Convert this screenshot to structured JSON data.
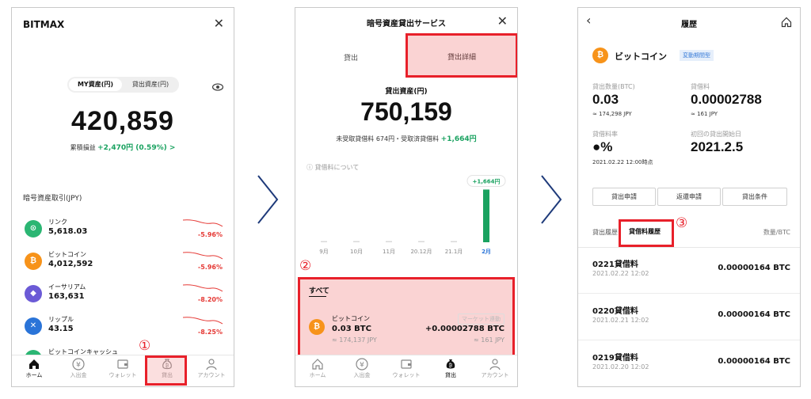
{
  "screen1": {
    "brand": "BITMAX",
    "pill_my": "MY資産(円)",
    "pill_lend": "貸出資産(円)",
    "total": "420,859",
    "pl_label": "累積損益",
    "pl_value": "+2,470円 (0.59%) >",
    "section_title": "暗号資産取引(JPY)",
    "coins": [
      {
        "name": "リンク",
        "price": "5,618.03",
        "change": "-5.96%",
        "color": "#2bb673",
        "glyph": "⊙"
      },
      {
        "name": "ビットコイン",
        "price": "4,012,592",
        "change": "-5.96%",
        "color": "#f7931a",
        "glyph": "₿"
      },
      {
        "name": "イーサリアム",
        "price": "163,631",
        "change": "-8.20%",
        "color": "#6b5ad6",
        "glyph": "◆"
      },
      {
        "name": "リップル",
        "price": "43.15",
        "change": "-8.25%",
        "color": "#2a74d8",
        "glyph": "✕"
      },
      {
        "name": "ビットコインキャッシュ",
        "price": "",
        "change": "",
        "color": "#2bb673",
        "glyph": ""
      }
    ],
    "tabs": [
      "ホーム",
      "入出金",
      "ウォレット",
      "貸出",
      "アカウント"
    ],
    "marker": "①"
  },
  "screen2": {
    "title": "暗号資産貸出サービス",
    "tab_lend": "貸出",
    "tab_detail": "貸出詳細",
    "asset_label": "貸出資産(円)",
    "asset_value": "750,159",
    "fee_summary_a": "未受取貸借料",
    "fee_summary_b": "674円・受取済貸借料",
    "fee_summary_c": "+1,664円",
    "fee_about": "ⓘ 貸借料について",
    "bar_badge": "+1,664円",
    "months": [
      "9月",
      "10月",
      "11月",
      "20.12月",
      "21.1月",
      "2月"
    ],
    "marker_2": "②",
    "all_label": "すべて",
    "coin_name": "ビットコイン",
    "coin_amount": "0.03 BTC",
    "coin_jpy": "≈ 174,137 JPY",
    "coin_tag": "マーケット連動",
    "coin_fee": "+0.00002788 BTC",
    "coin_fee_jpy": "≈ 161 JPY",
    "tabs": [
      "ホーム",
      "入出金",
      "ウォレット",
      "貸出",
      "アカウント"
    ]
  },
  "chart_data": {
    "type": "bar",
    "categories": [
      "9月",
      "10月",
      "11月",
      "20.12月",
      "21.1月",
      "2月"
    ],
    "values": [
      0,
      0,
      0,
      0,
      0,
      1664
    ],
    "title": "",
    "xlabel": "",
    "ylabel": "",
    "ylim": [
      0,
      1800
    ],
    "grid": false,
    "legend": "none",
    "colors": [
      "#1aa260"
    ]
  },
  "screen3": {
    "title": "履歴",
    "coin_name": "ビットコイン",
    "badge": "変動期間型",
    "qty_label": "貸出数量(BTC)",
    "qty_value": "0.03",
    "qty_jpy": "≈ 174,298 JPY",
    "fee_label": "貸借料",
    "fee_value": "0.00002788",
    "fee_jpy": "≈ 161 JPY",
    "rate_label": "貸借料率",
    "rate_value": "●%",
    "rate_date": "2021.02.22 12:00時点",
    "start_label": "初回の貸出開始日",
    "start_value": "2021.2.5",
    "btn_apply": "貸出申請",
    "btn_return": "返還申請",
    "btn_terms": "貸出条件",
    "tab_history": "貸出履歴",
    "tab_fee_history": "貸借料履歴",
    "marker_3": "③",
    "unit": "数量/BTC",
    "rows": [
      {
        "title": "0221貸借料",
        "date": "2021.02.22 12:02",
        "amount": "0.00000164 BTC"
      },
      {
        "title": "0220貸借料",
        "date": "2021.02.21 12:02",
        "amount": "0.00000164 BTC"
      },
      {
        "title": "0219貸借料",
        "date": "2021.02.20 12:02",
        "amount": "0.00000164 BTC"
      }
    ]
  }
}
